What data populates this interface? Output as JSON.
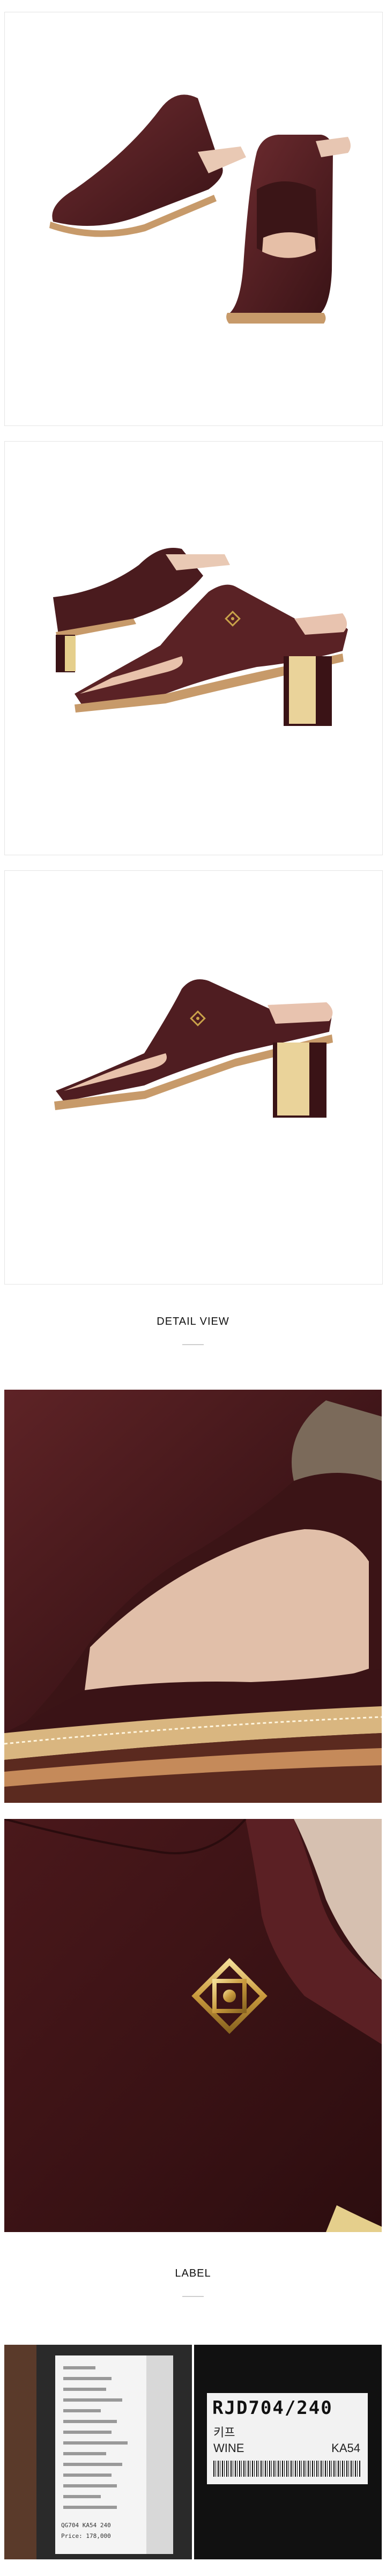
{
  "sections": {
    "detail_view": "DETAIL VIEW",
    "label": "LABEL"
  },
  "label_tag": {
    "model_big": "RJD704/240",
    "material": "키프",
    "color": "WINE",
    "code": "KA54",
    "price_line": "Price: 178,000",
    "style_line": "QG704  KA54  240"
  },
  "colors": {
    "leather": "#4a1b1e",
    "leather_light": "#6b2d30",
    "gold": "#c9a24a",
    "sole": "#c79a6a"
  }
}
